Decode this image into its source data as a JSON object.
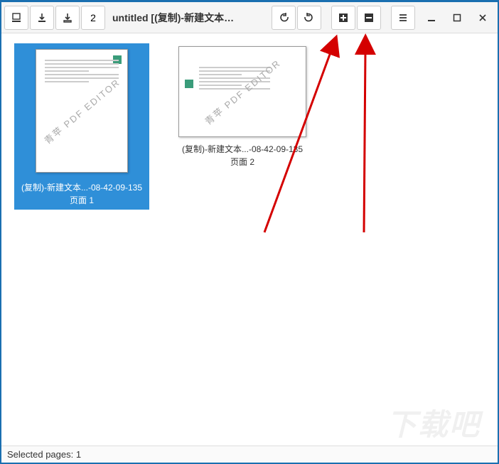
{
  "toolbar": {
    "page_count": "2"
  },
  "window": {
    "title": "untitled  [(复制)-新建文本文档 (2..."
  },
  "pages": [
    {
      "caption_line1": "(复制)-新建文本...-08-42-09-135",
      "caption_line2": "页面 1",
      "watermark": "青苹 PDF EDITOR"
    },
    {
      "caption_line1": "(复制)-新建文本...-08-42-09-135",
      "caption_line2": "页面 2",
      "watermark": "青苹 PDF EDITOR"
    }
  ],
  "status": {
    "selected_label": "Selected pages: 1"
  },
  "footer_watermark": "下载吧"
}
